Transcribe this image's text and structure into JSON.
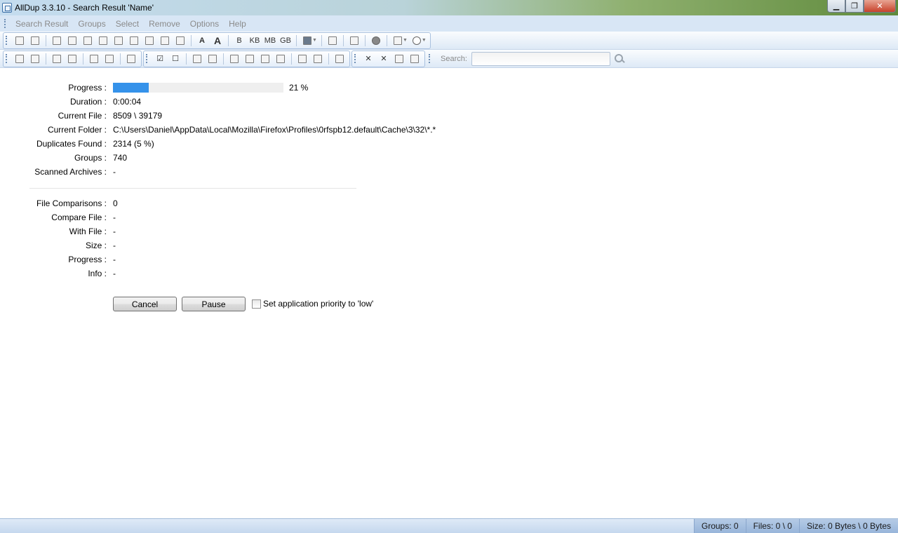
{
  "window": {
    "title": "AllDup 3.3.10 - Search Result 'Name'",
    "controls": [
      "minimize",
      "maximize",
      "close"
    ]
  },
  "menu": {
    "items": [
      "Search Result",
      "Groups",
      "Select",
      "Remove",
      "Options",
      "Help"
    ]
  },
  "toolbar1": {
    "size_units": [
      "B",
      "KB",
      "MB",
      "GB"
    ]
  },
  "toolbar2": {
    "search_label": "Search:",
    "search_value": ""
  },
  "progress": {
    "progress_label": "Progress :",
    "progress_fraction": 0.21,
    "progress_percent_text": "21 %",
    "duration_label": "Duration :",
    "duration_value": "0:00:04",
    "current_file_label": "Current File :",
    "current_file_value": "8509 \\ 39179",
    "current_folder_label": "Current Folder :",
    "current_folder_value": "C:\\Users\\Daniel\\AppData\\Local\\Mozilla\\Firefox\\Profiles\\0rfspb12.default\\Cache\\3\\32\\*.*",
    "duplicates_label": "Duplicates Found :",
    "duplicates_value": "2314 (5 %)",
    "groups_label": "Groups :",
    "groups_value": "740",
    "archives_label": "Scanned Archives :",
    "archives_value": "-"
  },
  "comparison": {
    "file_comparisons_label": "File Comparisons :",
    "file_comparisons_value": "0",
    "compare_file_label": "Compare File :",
    "compare_file_value": "-",
    "with_file_label": "With File :",
    "with_file_value": "-",
    "size_label": "Size :",
    "size_value": "-",
    "progress_label": "Progress :",
    "progress_value": "-",
    "info_label": "Info :",
    "info_value": "-"
  },
  "actions": {
    "cancel_label": "Cancel",
    "pause_label": "Pause",
    "low_priority_label": "Set application priority to 'low'",
    "low_priority_checked": false
  },
  "statusbar": {
    "groups": "Groups: 0",
    "files": "Files: 0 \\ 0",
    "size": "Size: 0 Bytes \\ 0 Bytes"
  },
  "colors": {
    "progress_fill": "#3592ea",
    "menu_bg": "#d8e6f5",
    "status_panel_bg": "#a9c2e2"
  }
}
